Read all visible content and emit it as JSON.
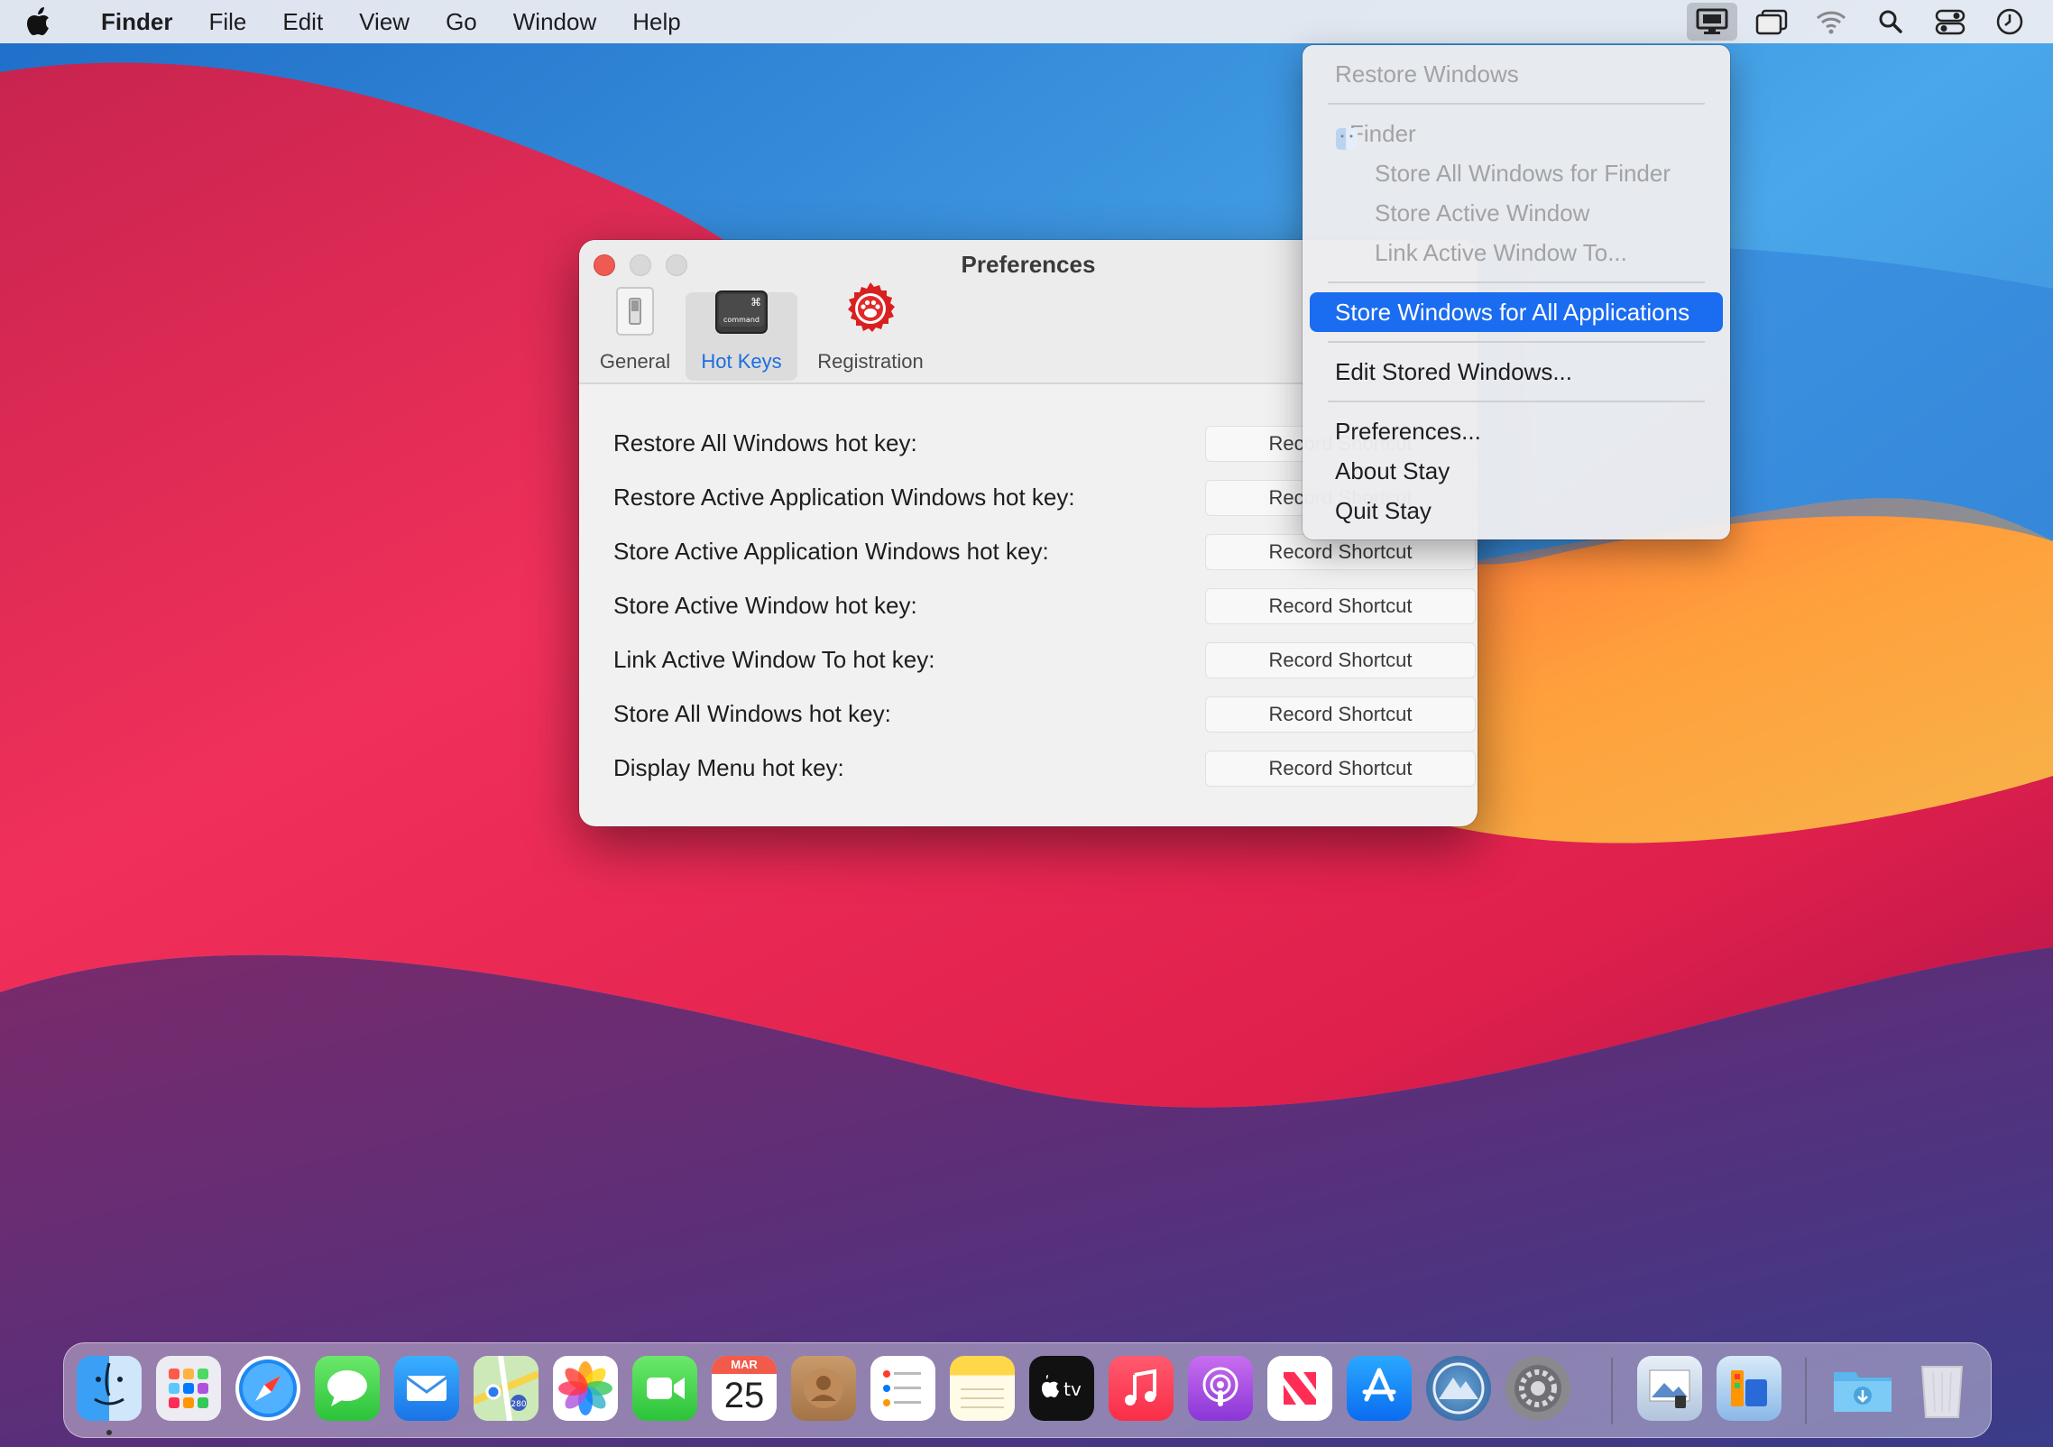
{
  "menubar": {
    "app_name": "Finder",
    "items": [
      "File",
      "Edit",
      "View",
      "Go",
      "Window",
      "Help"
    ],
    "status_icons": [
      "stay-icon",
      "window-icon",
      "wifi-icon",
      "search-icon",
      "control-center-icon",
      "clock-icon"
    ]
  },
  "preferences": {
    "title": "Preferences",
    "tabs": [
      {
        "label": "General",
        "icon": "switch-icon"
      },
      {
        "label": "Hot Keys",
        "icon": "command-key-icon"
      },
      {
        "label": "Registration",
        "icon": "paw-badge-icon"
      }
    ],
    "selected_tab": "Hot Keys",
    "rows": [
      {
        "label": "Restore All Windows hot key:",
        "button": "Record Shortcut"
      },
      {
        "label": "Restore Active Application Windows hot key:",
        "button": "Record Shortcut"
      },
      {
        "label": "Store Active Application Windows hot key:",
        "button": "Record Shortcut"
      },
      {
        "label": "Store Active Window hot key:",
        "button": "Record Shortcut"
      },
      {
        "label": "Link Active Window To hot key:",
        "button": "Record Shortcut"
      },
      {
        "label": "Store All Windows hot key:",
        "button": "Record Shortcut"
      },
      {
        "label": "Display Menu hot key:",
        "button": "Record Shortcut"
      }
    ]
  },
  "dropdown": {
    "restore_windows": "Restore Windows",
    "finder_header": "Finder",
    "store_all_finder": "Store All Windows for Finder",
    "store_active_window": "Store Active Window",
    "link_active_window": "Link Active Window To...",
    "store_all_apps": "Store Windows for All Applications",
    "edit_stored": "Edit Stored Windows...",
    "preferences": "Preferences...",
    "about": "About Stay",
    "quit": "Quit Stay"
  },
  "dock": {
    "calendar_month": "MAR",
    "calendar_day": "25",
    "apps": [
      "Finder",
      "Launchpad",
      "Safari",
      "Messages",
      "Mail",
      "Maps",
      "Photos",
      "FaceTime",
      "Calendar",
      "Contacts",
      "Reminders",
      "Notes",
      "TV",
      "Music",
      "Podcasts",
      "News",
      "App Store",
      "Big Sur Installer",
      "System Preferences",
      "Preview",
      "Stay",
      "Downloads",
      "Trash"
    ]
  },
  "colors": {
    "highlight": "#1a6cf0",
    "selected_tab_text": "#1b6ee0",
    "close_button": "#ee5b52"
  }
}
